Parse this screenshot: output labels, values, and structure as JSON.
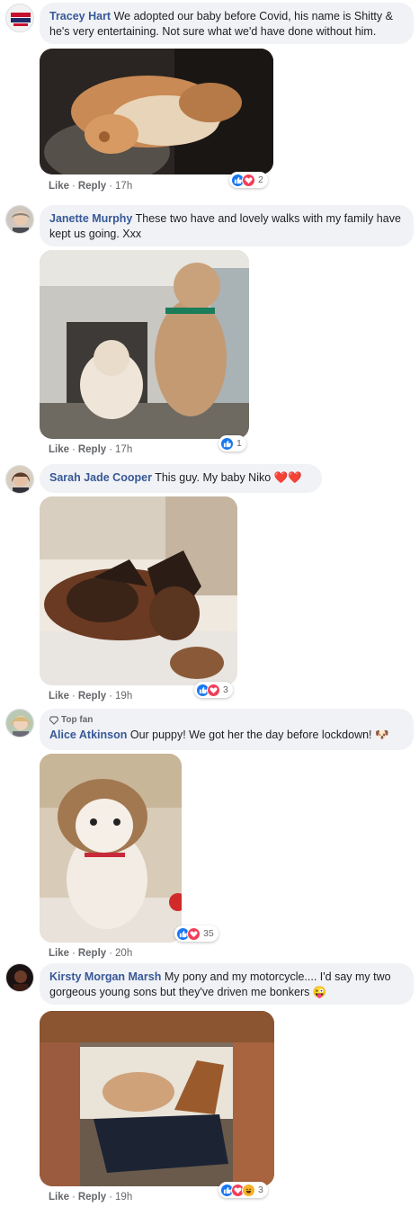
{
  "comments": [
    {
      "author": "Tracey Hart",
      "text": "We adopted our baby before Covid, his name is Shitty & he's very entertaining. Not sure what we'd have done without him.",
      "like": "Like",
      "reply": "Reply",
      "time": "17h",
      "reactions": [
        "like-icon",
        "love-icon"
      ],
      "reaction_count": "2"
    },
    {
      "author": "Janette Murphy",
      "text": "These two have and lovely walks with my family have kept us going. Xxx",
      "like": "Like",
      "reply": "Reply",
      "time": "17h",
      "reactions": [
        "like-icon"
      ],
      "reaction_count": "1"
    },
    {
      "author": "Sarah Jade Cooper",
      "text": "This guy. My baby Niko ❤️❤️",
      "like": "Like",
      "reply": "Reply",
      "time": "19h",
      "reactions": [
        "like-icon",
        "love-icon"
      ],
      "reaction_count": "3"
    },
    {
      "badge": "Top fan",
      "author": "Alice Atkinson",
      "text": "Our puppy! We got her the day before lockdown! 🐶",
      "like": "Like",
      "reply": "Reply",
      "time": "20h",
      "reactions": [
        "like-icon",
        "love-icon"
      ],
      "reaction_count": "35"
    },
    {
      "author": "Kirsty Morgan Marsh",
      "text": "My pony and my motorcycle.... I'd say my two gorgeous young sons but they've driven me bonkers 😜",
      "like": "Like",
      "reply": "Reply",
      "time": "19h",
      "reactions": [
        "like-icon",
        "love-icon",
        "haha-icon"
      ],
      "reaction_count": "3"
    }
  ],
  "colors": {
    "link": "#385898",
    "bubble": "#f0f2f5",
    "like": "#1877f2",
    "love": "#f33e58",
    "haha": "#f7b125"
  }
}
